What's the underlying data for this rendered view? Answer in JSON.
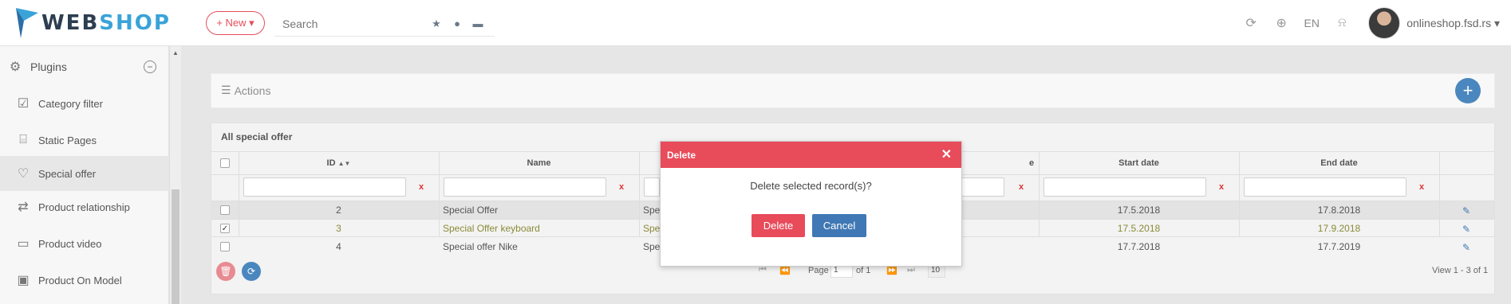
{
  "header": {
    "logo_text_a": "WEB",
    "logo_text_b": "SHOP",
    "new_label": "+ New ▾",
    "search_placeholder": "Search",
    "lang": "EN",
    "user": "onlineshop.fsd.rs ▾",
    "icons": [
      "star-icon",
      "user-icon",
      "cart-icon",
      "refresh-icon",
      "globe-icon",
      "bell-icon"
    ]
  },
  "sidebar": {
    "header": "Plugins",
    "items": [
      {
        "label": "Category filter",
        "icon": "checkbox-icon"
      },
      {
        "label": "Static Pages",
        "icon": "bookmark-icon"
      },
      {
        "label": "Special offer",
        "icon": "heart-icon"
      },
      {
        "label": "Product relationship",
        "icon": "shuffle-icon"
      },
      {
        "label": "Product video",
        "icon": "video-icon"
      },
      {
        "label": "Product On Model",
        "icon": "image-icon"
      }
    ],
    "active_item": "Special offer"
  },
  "actions": {
    "label": "Actions"
  },
  "grid": {
    "title": "All special offer",
    "columns": [
      "ID",
      "Name",
      "e",
      "Start date",
      "End date"
    ],
    "clear": "x",
    "rows": [
      {
        "id": "2",
        "name": "Special Offer",
        "type": "Spec",
        "start": "17.5.2018",
        "end": "17.8.2018",
        "checked": false
      },
      {
        "id": "3",
        "name": "Special Offer keyboard",
        "type": "Spec",
        "start": "17.5.2018",
        "end": "17.9.2018",
        "checked": true
      },
      {
        "id": "4",
        "name": "Special offer Nike",
        "type": "Spec",
        "start": "17.7.2018",
        "end": "17.7.2019",
        "checked": false
      }
    ],
    "pager": {
      "page_label": "Page",
      "page_value": "1",
      "of_label": "of 1",
      "page_size": "10",
      "view_text": "View 1 - 3 of 1"
    }
  },
  "modal": {
    "title": "Delete",
    "message": "Delete selected record(s)?",
    "delete_label": "Delete",
    "cancel_label": "Cancel"
  },
  "colors": {
    "accent_red": "#e84b5a",
    "accent_blue": "#3f78b4"
  }
}
